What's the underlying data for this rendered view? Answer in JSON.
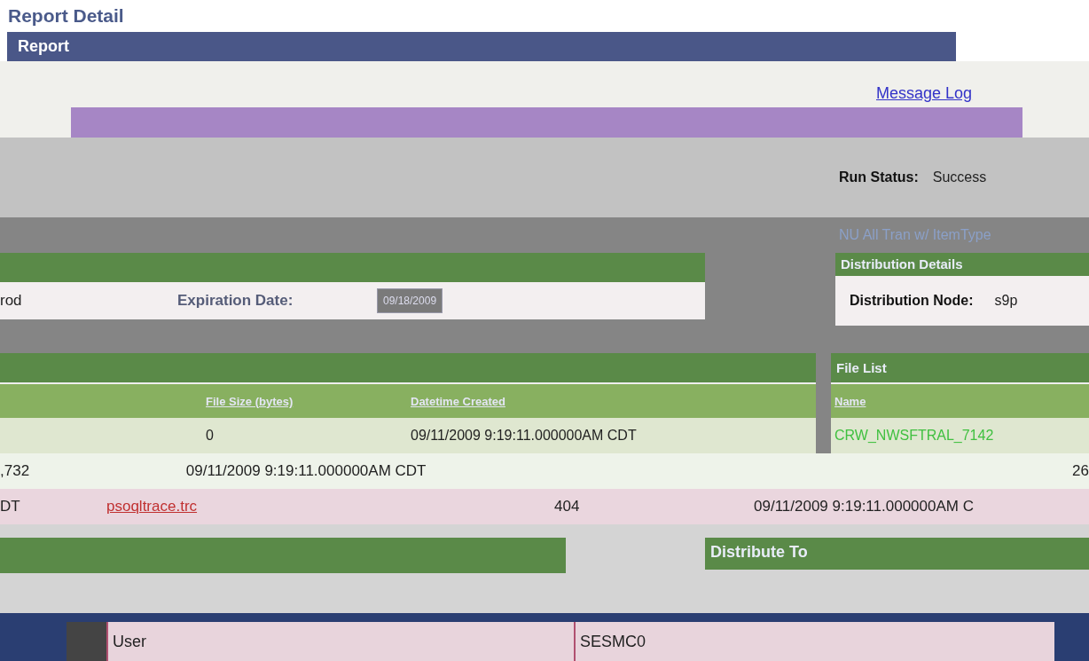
{
  "page_title": "Report Detail",
  "report_section": {
    "title": "Report",
    "message_log_link": "Message Log",
    "run_status_label": "Run Status:",
    "run_status_value": "Success"
  },
  "description": "NU All Tran w/ ItemType",
  "report_panel": {
    "node_fragment": "rod",
    "expiration_label": "Expiration Date:",
    "expiration_value": "09/18/2009"
  },
  "distribution_details": {
    "title": "Distribution Details",
    "node_label": "Distribution Node:",
    "node_value": "s9p"
  },
  "file_table": {
    "columns": [
      "File Size (bytes)",
      "Datetime Created"
    ],
    "rows": [
      {
        "file_size": "0",
        "created": "09/11/2009 9:19:11.000000AM CDT"
      }
    ]
  },
  "file_list": {
    "title": "File List",
    "column": "Name",
    "name": "CRW_NWSFTRAL_7142"
  },
  "detail_rows": [
    {
      "kind": "size",
      "cells": [
        ",732",
        "09/11/2009 9:19:11.000000AM CDT",
        "26"
      ]
    },
    {
      "kind": "trace",
      "cells": [
        "DT",
        "psoqltrace.trc",
        "404",
        "09/11/2009 9:19:11.000000AM C"
      ]
    }
  ],
  "distribute_to": {
    "title": "Distribute To",
    "rows": [
      {
        "type": "User",
        "id": "SESMC0"
      }
    ]
  }
}
